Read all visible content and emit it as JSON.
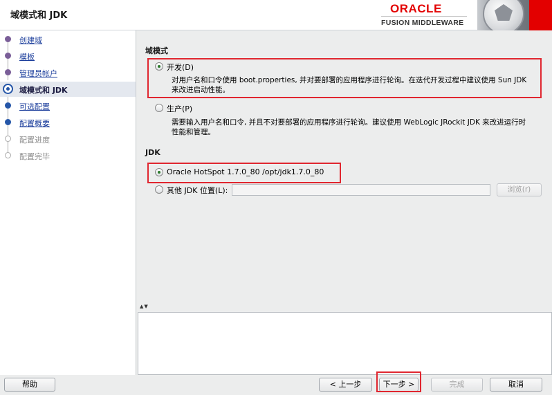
{
  "header": {
    "title": "域模式和 JDK",
    "logo_brand": "ORACLE",
    "logo_sub": "FUSION MIDDLEWARE"
  },
  "nav": {
    "items": [
      {
        "label": "创建域",
        "state": "done"
      },
      {
        "label": "模板",
        "state": "done"
      },
      {
        "label": "管理员帐户",
        "state": "done"
      },
      {
        "label": "域模式和 JDK",
        "state": "active"
      },
      {
        "label": "可选配置",
        "state": "todo"
      },
      {
        "label": "配置概要",
        "state": "todo"
      },
      {
        "label": "配置进度",
        "state": "disabled"
      },
      {
        "label": "配置完毕",
        "state": "disabled"
      }
    ]
  },
  "domain_mode": {
    "section_label": "域模式",
    "development": {
      "label": "开发(D)",
      "checked": true,
      "description_line1": "对用户名和口令使用 boot.properties, 并对要部署的应用程序进行轮询。在迭代开发过程中建议使用 Sun JDK",
      "description_line2": "来改进启动性能。"
    },
    "production": {
      "label": "生产(P)",
      "checked": false,
      "description_line1": "需要输入用户名和口令, 并且不对要部署的应用程序进行轮询。建议使用 WebLogic JRockit JDK 来改进运行时",
      "description_line2": "性能和管理。"
    }
  },
  "jdk": {
    "section_label": "JDK",
    "hotspot": {
      "label": "Oracle HotSpot 1.7.0_80 /opt/jdk1.7.0_80",
      "checked": true
    },
    "other": {
      "label": "其他 JDK 位置(L):",
      "checked": false,
      "value": "",
      "browse_label": "浏览(r)"
    }
  },
  "footer": {
    "help": "帮助",
    "back": "< 上一步",
    "next": "下一步 >",
    "finish": "完成",
    "cancel": "取消"
  },
  "colors": {
    "highlight_box": "#e0262f",
    "oracle_red": "#e30000",
    "nav_link": "#1c3e9c"
  }
}
